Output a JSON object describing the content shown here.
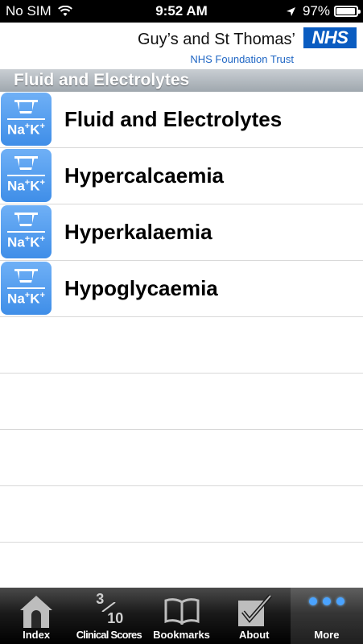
{
  "status_bar": {
    "carrier": "No SIM",
    "time": "9:52 AM",
    "battery": "97%",
    "battery_level": 0.97
  },
  "header": {
    "org_name": "Guy’s and St Thomas’",
    "org_subtitle": "NHS Foundation Trust",
    "logo_text": "NHS"
  },
  "section": {
    "title": "Fluid and Electrolytes"
  },
  "list": {
    "icon_text": "Na",
    "items": [
      {
        "label": "Fluid and Electrolytes"
      },
      {
        "label": "Hypercalcaemia"
      },
      {
        "label": "Hyperkalaemia"
      },
      {
        "label": "Hypoglycaemia"
      }
    ]
  },
  "tab_bar": {
    "tabs": [
      {
        "label": "Index"
      },
      {
        "label": "Clinical Scores",
        "icon_num": "3",
        "icon_den": "10"
      },
      {
        "label": "Bookmarks"
      },
      {
        "label": "About"
      },
      {
        "label": "More"
      }
    ]
  },
  "colors": {
    "nhs_blue": "#0a5cc1",
    "icon_blue": "#4a96ea",
    "active_dots": "#4aa3ff"
  }
}
